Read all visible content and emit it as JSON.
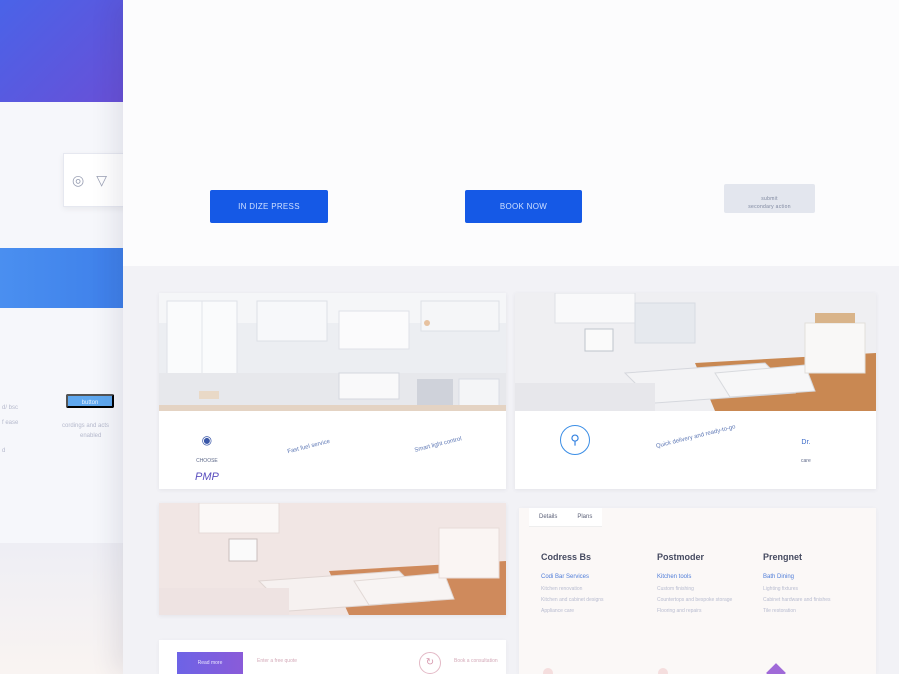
{
  "background_panel": {
    "faint_lines": [
      "d/ bsc",
      "f ease",
      "d"
    ],
    "pill_label": "button",
    "small_lines": [
      "cordings and acts",
      "enabled"
    ]
  },
  "hero": {
    "faint_caption": "",
    "buttons": [
      {
        "label": "IN DIZE PRESS"
      },
      {
        "label": "BOOK NOW"
      }
    ],
    "ghost_button": {
      "line1": "submit",
      "line2": "secondary action"
    }
  },
  "cards": [
    {
      "features": [
        {
          "icon": "badge-icon",
          "label": "CHOOSE",
          "big": "PMP"
        },
        {
          "label": "Fast fuel service"
        },
        {
          "label": "Smart light control"
        }
      ]
    },
    {
      "features": [
        {
          "icon": "lock-icon",
          "label": ""
        },
        {
          "label": "Quick delivery and ready-to-go"
        },
        {
          "label": "Dr.",
          "small": "care"
        }
      ]
    }
  ],
  "info": {
    "tabs": [
      "Details",
      "Plans"
    ],
    "columns": [
      {
        "title": "Codress Bs",
        "sub": "Codi Bar Services",
        "lines": [
          "Kitchen renovation",
          "Kitchen and cabinet designs",
          "Appliance care"
        ]
      },
      {
        "title": "Postmoder",
        "sub": "Kitchen tools",
        "lines": [
          "Custom finishing",
          "Countertops and bespoke storage",
          "Flooring and repairs"
        ]
      },
      {
        "title": "Prengnet",
        "sub": "Bath Dining",
        "lines": [
          "Lighting fixtures",
          "Cabinet hardware and finishes",
          "Tile restoration"
        ]
      }
    ]
  },
  "bottom": {
    "button_label": "Read more",
    "text_left": "Enter a free quote",
    "text_right": "Book a consultation"
  },
  "colors": {
    "primary": "#1559e6",
    "accent": "#6a4fd6"
  }
}
